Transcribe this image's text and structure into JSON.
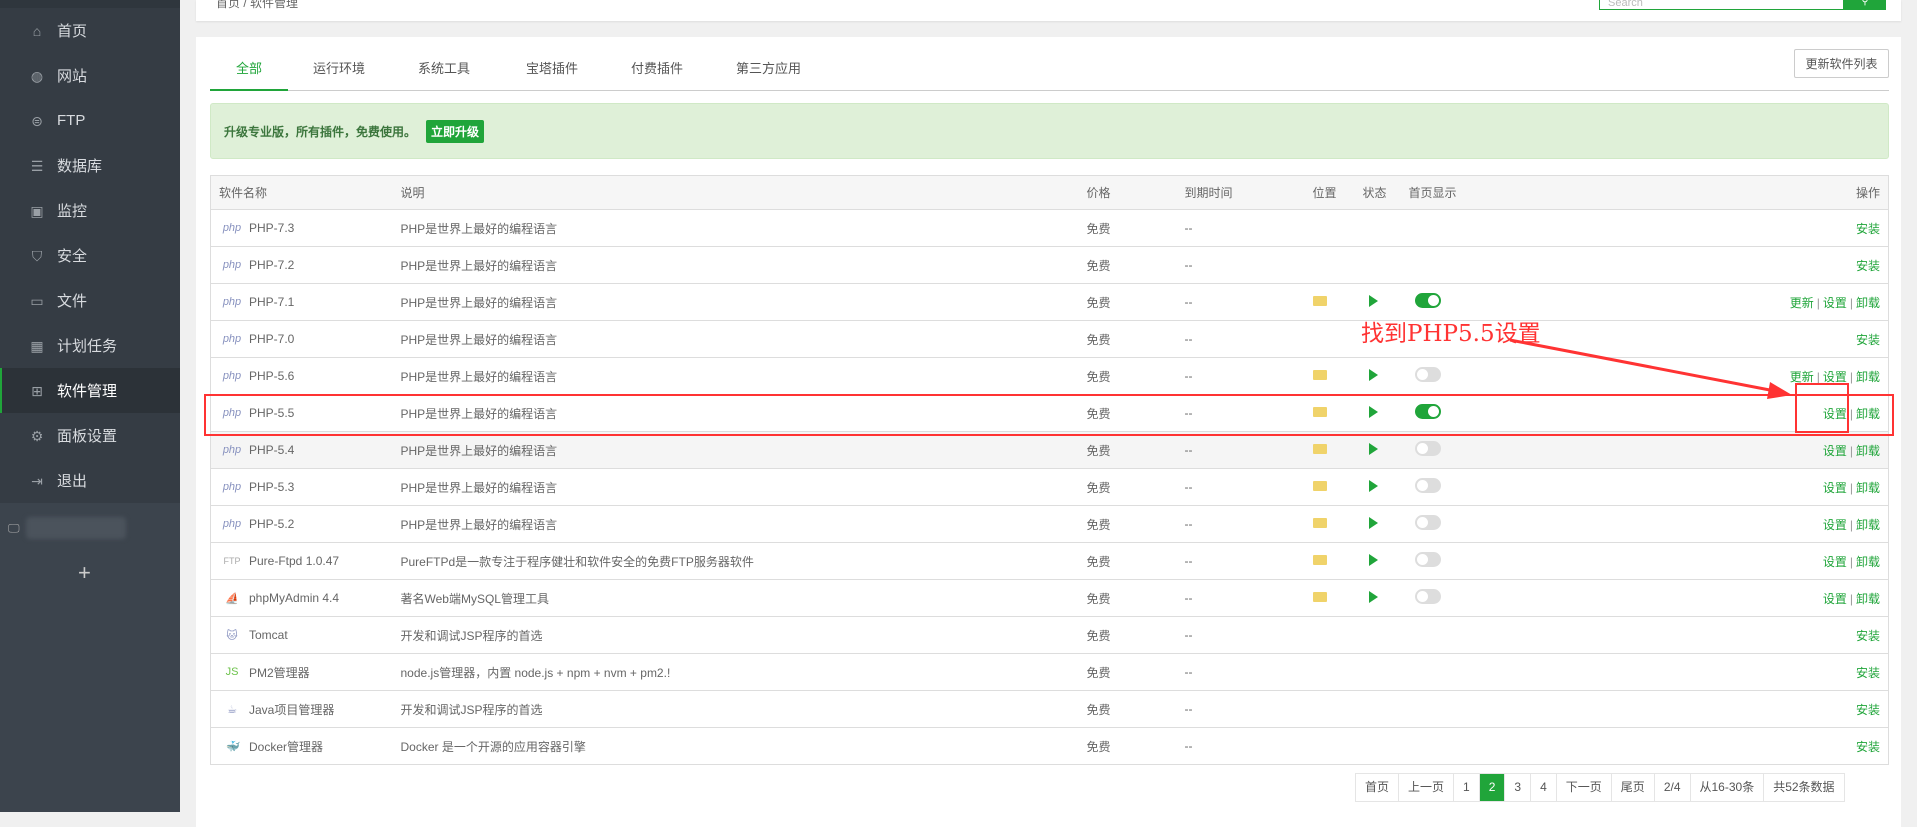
{
  "sidebar": {
    "items": [
      {
        "label": "首页",
        "icon": "home-icon"
      },
      {
        "label": "网站",
        "icon": "globe-icon"
      },
      {
        "label": "FTP",
        "icon": "ftp-icon"
      },
      {
        "label": "数据库",
        "icon": "database-icon"
      },
      {
        "label": "监控",
        "icon": "monitor-icon"
      },
      {
        "label": "安全",
        "icon": "shield-icon"
      },
      {
        "label": "文件",
        "icon": "folder-icon"
      },
      {
        "label": "计划任务",
        "icon": "calendar-icon"
      },
      {
        "label": "软件管理",
        "icon": "grid-icon"
      },
      {
        "label": "面板设置",
        "icon": "gear-icon"
      },
      {
        "label": "退出",
        "icon": "logout-icon"
      }
    ],
    "add": "+"
  },
  "header": {
    "breadcrumb": "首页 / 软件管理",
    "search_placeholder": "Search"
  },
  "tabs": [
    "全部",
    "运行环境",
    "系统工具",
    "宝塔插件",
    "付费插件",
    "第三方应用"
  ],
  "refresh_label": "更新软件列表",
  "banner": {
    "text": "升级专业版，所有插件，免费使用。",
    "button": "立即升级"
  },
  "table": {
    "headers": [
      "软件名称",
      "说明",
      "价格",
      "到期时间",
      "位置",
      "状态",
      "首页显示",
      "操作"
    ],
    "rows": [
      {
        "name": "PHP-7.3",
        "desc": "PHP是世界上最好的编程语言",
        "price": "免费",
        "expire": "--",
        "ops": [
          "安装"
        ]
      },
      {
        "name": "PHP-7.2",
        "desc": "PHP是世界上最好的编程语言",
        "price": "免费",
        "expire": "--",
        "ops": [
          "安装"
        ]
      },
      {
        "name": "PHP-7.1",
        "desc": "PHP是世界上最好的编程语言",
        "price": "免费",
        "expire": "--",
        "installed": true,
        "home": true,
        "ops": [
          "更新",
          "设置",
          "卸载"
        ]
      },
      {
        "name": "PHP-7.0",
        "desc": "PHP是世界上最好的编程语言",
        "price": "免费",
        "expire": "--",
        "ops": [
          "安装"
        ]
      },
      {
        "name": "PHP-5.6",
        "desc": "PHP是世界上最好的编程语言",
        "price": "免费",
        "expire": "--",
        "installed": true,
        "home": false,
        "ops": [
          "更新",
          "设置",
          "卸载"
        ]
      },
      {
        "name": "PHP-5.5",
        "desc": "PHP是世界上最好的编程语言",
        "price": "免费",
        "expire": "--",
        "installed": true,
        "home": true,
        "ops": [
          "设置",
          "卸载"
        ]
      },
      {
        "name": "PHP-5.4",
        "desc": "PHP是世界上最好的编程语言",
        "price": "免费",
        "expire": "--",
        "installed": true,
        "home": false,
        "ops": [
          "设置",
          "卸载"
        ]
      },
      {
        "name": "PHP-5.3",
        "desc": "PHP是世界上最好的编程语言",
        "price": "免费",
        "expire": "--",
        "installed": true,
        "home": false,
        "ops": [
          "设置",
          "卸载"
        ]
      },
      {
        "name": "PHP-5.2",
        "desc": "PHP是世界上最好的编程语言",
        "price": "免费",
        "expire": "--",
        "installed": true,
        "home": false,
        "ops": [
          "设置",
          "卸载"
        ]
      },
      {
        "name": "Pure-Ftpd 1.0.47",
        "logo": "FTP",
        "desc": "PureFTPd是一款专注于程序健壮和软件安全的免费FTP服务器软件",
        "price": "免费",
        "expire": "--",
        "installed": true,
        "home": false,
        "ops": [
          "设置",
          "卸载"
        ]
      },
      {
        "name": "phpMyAdmin 4.4",
        "logo": "⛵",
        "desc": "著名Web端MySQL管理工具",
        "price": "免费",
        "expire": "--",
        "installed": true,
        "home": false,
        "ops": [
          "设置",
          "卸载"
        ]
      },
      {
        "name": "Tomcat",
        "logo": "🐱",
        "desc": "开发和调试JSP程序的首选",
        "price": "免费",
        "expire": "--",
        "ops": [
          "安装"
        ]
      },
      {
        "name": "PM2管理器",
        "logo": "JS",
        "desc": "node.js管理器，内置 node.js + npm + nvm + pm2.!",
        "price": "免费",
        "expire": "--",
        "ops": [
          "安装"
        ]
      },
      {
        "name": "Java项目管理器",
        "logo": "☕",
        "desc": "开发和调试JSP程序的首选",
        "price": "免费",
        "expire": "--",
        "ops": [
          "安装"
        ]
      },
      {
        "name": "Docker管理器",
        "logo": "🐳",
        "desc": "Docker 是一个开源的应用容器引擎",
        "price": "免费",
        "expire": "--",
        "ops": [
          "安装"
        ]
      }
    ]
  },
  "pagination": [
    "首页",
    "上一页",
    "1",
    "2",
    "3",
    "4",
    "下一页",
    "尾页",
    "2/4",
    "从16-30条",
    "共52条数据"
  ],
  "pagination_current": "2",
  "annotation": "找到PHP5.5设置",
  "colors": {
    "accent": "#20a53a",
    "annotation": "#ff3333",
    "sidebar": "#3c444d"
  }
}
